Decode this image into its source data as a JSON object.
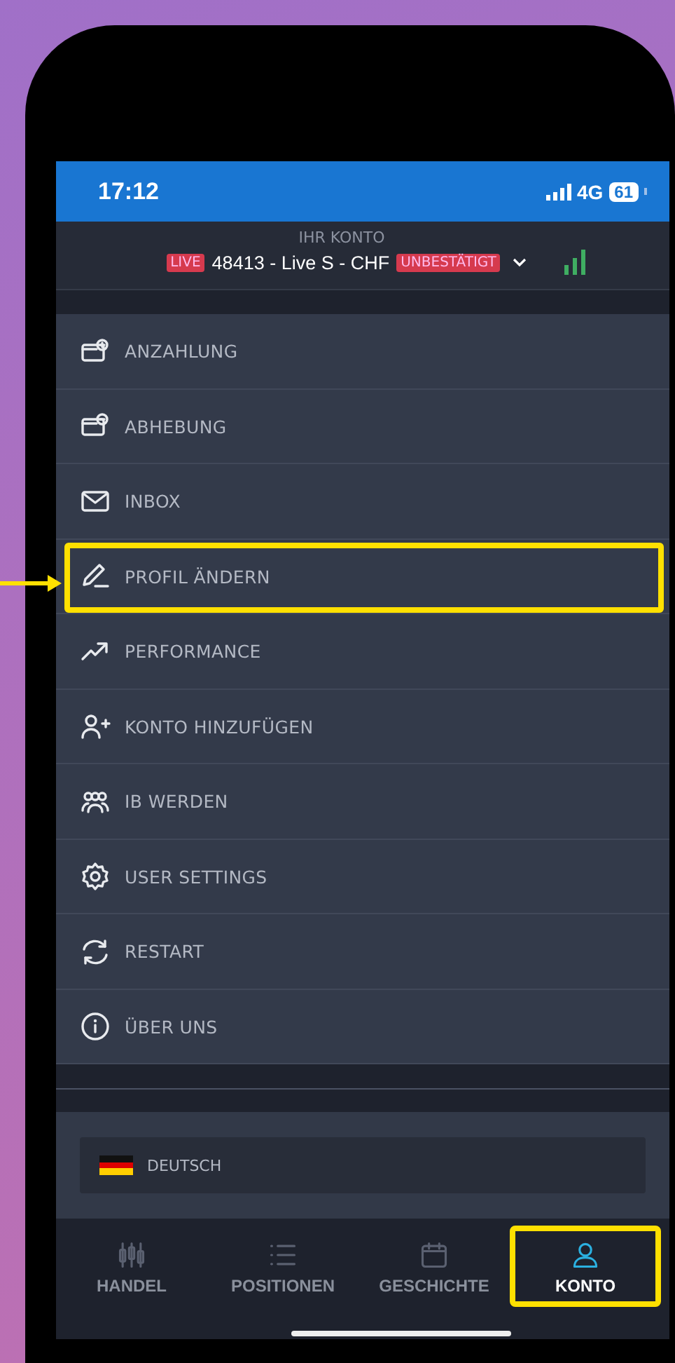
{
  "status_bar": {
    "time": "17:12",
    "network": "4G",
    "battery": "61"
  },
  "account": {
    "label": "IHR KONTO",
    "badge": "LIVE",
    "name": "48413 - Live S - CHF",
    "status": "UNBESTÄTIGT"
  },
  "menu": [
    {
      "label": "ANZAHLUNG",
      "highlighted": false
    },
    {
      "label": "ABHEBUNG",
      "highlighted": false
    },
    {
      "label": "INBOX",
      "highlighted": false
    },
    {
      "label": "PROFIL ÄNDERN",
      "highlighted": true
    },
    {
      "label": "PERFORMANCE",
      "highlighted": false
    },
    {
      "label": "KONTO HINZUFÜGEN",
      "highlighted": false
    },
    {
      "label": "IB WERDEN",
      "highlighted": false
    },
    {
      "label": "USER SETTINGS",
      "highlighted": false
    },
    {
      "label": "RESTART",
      "highlighted": false
    },
    {
      "label": "ÜBER UNS",
      "highlighted": false
    }
  ],
  "language": {
    "label": "DEUTSCH"
  },
  "bottom_nav": [
    {
      "label": "HANDEL",
      "selected": false,
      "highlighted": false
    },
    {
      "label": "POSITIONEN",
      "selected": false,
      "highlighted": false
    },
    {
      "label": "GESCHICHTE",
      "selected": false,
      "highlighted": false
    },
    {
      "label": "KONTO",
      "selected": true,
      "highlighted": true
    }
  ]
}
